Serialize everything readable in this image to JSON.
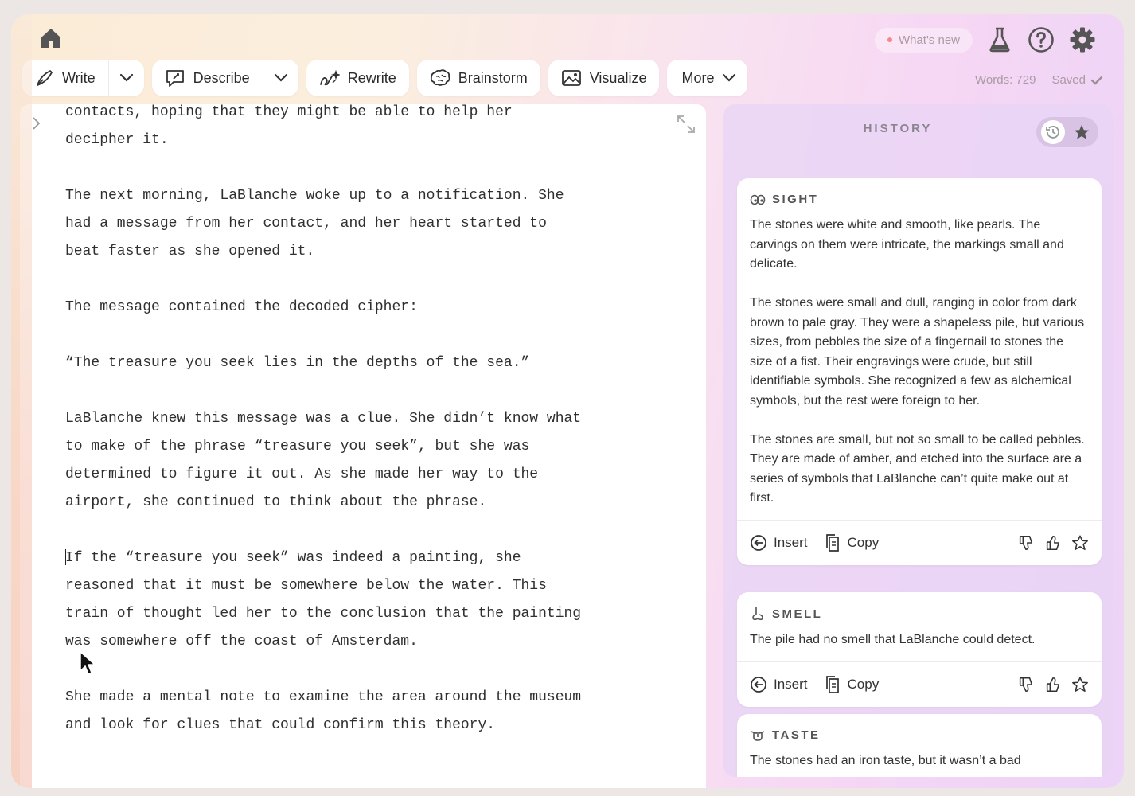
{
  "topbar": {
    "whats_new": "What's new"
  },
  "toolbar": {
    "write": "Write",
    "describe": "Describe",
    "rewrite": "Rewrite",
    "brainstorm": "Brainstorm",
    "visualize": "Visualize",
    "more": "More"
  },
  "status": {
    "words": "Words: 729",
    "saved": "Saved"
  },
  "editor": {
    "paragraphs": [
      "contacts, hoping that they might be able to help her\ndecipher it.",
      "The next morning, LaBlanche woke up to a notification. She\nhad a message from her contact, and her heart started to\nbeat faster as she opened it.",
      "The message contained the decoded cipher:",
      "“The treasure you seek lies in the depths of the sea.”",
      "LaBlanche knew this message was a clue. She didn’t know what\nto make of the phrase “treasure you seek”, but she was\ndetermined to figure it out. As she made her way to the\nairport, she continued to think about the phrase.",
      "If the “treasure you seek” was indeed a painting, she\nreasoned that it must be somewhere below the water. This\ntrain of thought led her to the conclusion that the painting\nwas somewhere off the coast of Amsterdam.",
      "She made a mental note to examine the area around the museum\nand look for clues that could confirm this theory."
    ]
  },
  "history": {
    "title": "HISTORY",
    "cards": [
      {
        "label": "SIGHT",
        "paragraphs": [
          "The stones were white and smooth, like pearls. The carvings on them were intricate, the markings small and delicate.",
          "The stones were small and dull, ranging in color from dark brown to pale gray. They were a shapeless pile, but various sizes, from pebbles the size of a fingernail to stones the size of a fist. Their engravings were crude, but still identifiable symbols. She recognized a few as alchemical symbols, but the rest were foreign to her.",
          "The stones are small, but not so small to be called pebbles. They are made of amber, and etched into the surface are a series of symbols that LaBlanche can’t quite make out at first."
        ],
        "insert": "Insert",
        "copy": "Copy"
      },
      {
        "label": "SMELL",
        "paragraphs": [
          "The pile had no smell that LaBlanche could detect."
        ],
        "insert": "Insert",
        "copy": "Copy"
      },
      {
        "label": "TASTE",
        "paragraphs": [
          "The stones had an iron taste, but it wasn’t a bad"
        ]
      }
    ]
  },
  "colors": {
    "accent_dot": "#f28a8a",
    "muted": "#a99aa3",
    "panel": "#e8d4f6"
  },
  "icons": [
    "home-icon",
    "beaker-icon",
    "help-icon",
    "gear-icon",
    "pen-icon",
    "chevron-down-icon",
    "describe-icon",
    "rewrite-icon",
    "brain-icon",
    "image-icon",
    "checkmark-icon",
    "chevron-right-icon",
    "expand-icon",
    "history-icon",
    "star-icon",
    "eye-icon",
    "nose-icon",
    "tongue-icon",
    "insert-icon",
    "copy-icon",
    "thumbs-down-icon",
    "thumbs-up-icon",
    "cursor-icon"
  ]
}
